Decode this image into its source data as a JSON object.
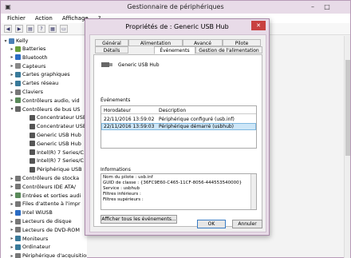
{
  "main_window": {
    "title": "Gestionnaire de périphériques",
    "minimize": "–",
    "maximize": "□",
    "menu": [
      "Fichier",
      "Action",
      "Affichage",
      "?"
    ],
    "toolbar_icons": [
      "back-icon",
      "forward-icon",
      "properties-icon",
      "help-icon",
      "scan-icon",
      "monitor-icon"
    ]
  },
  "tree": {
    "root": "Kelly",
    "items": [
      {
        "label": "Batteries",
        "expander": "▸",
        "color": "#6a9f3a"
      },
      {
        "label": "Bluetooth",
        "expander": "▸",
        "color": "#2b6cc4"
      },
      {
        "label": "Capteurs",
        "expander": "▸",
        "color": "#888888"
      },
      {
        "label": "Cartes graphiques",
        "expander": "▸",
        "color": "#3a7a9a"
      },
      {
        "label": "Cartes réseau",
        "expander": "▸",
        "color": "#3a7a9a"
      },
      {
        "label": "Claviers",
        "expander": "▸",
        "color": "#777777"
      },
      {
        "label": "Contrôleurs audio, vid",
        "expander": "▸",
        "color": "#5a8a5a"
      },
      {
        "label": "Contrôleurs de bus US",
        "expander": "▾",
        "color": "#666666"
      },
      {
        "label": "Concentrateur USB",
        "expander": "",
        "color": "#555555"
      },
      {
        "label": "Concentrateur USB",
        "expander": "",
        "color": "#555555"
      },
      {
        "label": "Generic USB Hub",
        "expander": "",
        "color": "#555555"
      },
      {
        "label": "Generic USB Hub",
        "expander": "",
        "color": "#555555"
      },
      {
        "label": "Intel(R) 7 Series/C",
        "expander": "",
        "color": "#555555"
      },
      {
        "label": "Intel(R) 7 Series/C",
        "expander": "",
        "color": "#555555"
      },
      {
        "label": "Périphérique USB",
        "expander": "",
        "color": "#555555"
      },
      {
        "label": "Contrôleurs de stocka",
        "expander": "▸",
        "color": "#777777"
      },
      {
        "label": "Contrôleurs IDE ATA/",
        "expander": "▸",
        "color": "#777777"
      },
      {
        "label": "Entrées et sorties audi",
        "expander": "▸",
        "color": "#5a8a5a"
      },
      {
        "label": "Files d'attente à l'impr",
        "expander": "▸",
        "color": "#777777"
      },
      {
        "label": "Intel WiUSB",
        "expander": "▸",
        "color": "#2b6cc4"
      },
      {
        "label": "Lecteurs de disque",
        "expander": "▸",
        "color": "#777777"
      },
      {
        "label": "Lecteurs de DVD-ROM",
        "expander": "▸",
        "color": "#777777"
      },
      {
        "label": "Moniteurs",
        "expander": "▸",
        "color": "#3a7a9a"
      },
      {
        "label": "Ordinateur",
        "expander": "▸",
        "color": "#3a7a9a"
      },
      {
        "label": "Périphérique d'acquisition d'images",
        "expander": "▸",
        "color": "#777777"
      }
    ]
  },
  "dialog": {
    "title": "Propriétés de : Generic USB Hub",
    "close": "✕",
    "tabs_row1": [
      "Général",
      "Alimentation",
      "Avancé",
      "Pilote"
    ],
    "tabs_row2": [
      "Détails",
      "Événements",
      "Gestion de l'alimentation"
    ],
    "selected_tab": "Événements",
    "device_name": "Generic USB Hub",
    "events_label": "Événements",
    "events_columns": [
      "Horodateur",
      "Description"
    ],
    "events": [
      {
        "time": "22/11/2016 13:59:02",
        "description": "Périphérique configuré (usb.inf)"
      },
      {
        "time": "22/11/2016 13:59:03",
        "description": "Périphérique démarré (usbhub)"
      }
    ],
    "info_label": "Informations",
    "info_lines": [
      "Nom du pilote : usb.inf",
      "GUID de classe : {36FC9E60-C465-11CF-8056-444553540000}",
      "Service : usbhub",
      "Filtres inférieurs :",
      "Filtres supérieurs :"
    ],
    "show_all_button": "Afficher tous les événements...",
    "ok_button": "OK",
    "cancel_button": "Annuler"
  }
}
